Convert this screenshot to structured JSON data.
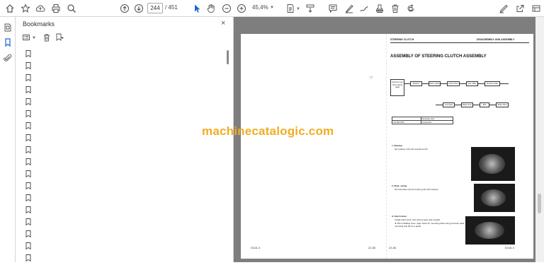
{
  "toolbar": {
    "current_page": "244",
    "total_pages": "/ 451",
    "zoom": "45,4%"
  },
  "bookmarks_panel": {
    "title": "Bookmarks",
    "item_count": 16
  },
  "document": {
    "left_page": {
      "page_number": "22-83",
      "footer_code": "D115-3"
    },
    "right_page": {
      "header_left": "STEERING CLUTCH",
      "header_right": "DISASSEMBLY AND ASSEMBLY",
      "title": "ASSEMBLY OF STEERING CLUTCH ASSEMBLY",
      "flow_top": [
        "Retainer",
        "Plate, spring",
        "Clutch drum",
        "Disc, Plate",
        "Pressure plate"
      ],
      "flow_bottom": [
        "Lock plate",
        "Brake drum",
        "Bolt",
        "Brake band"
      ],
      "flow_start_label": "Clutch & inner drum (spring cage)",
      "table": {
        "header": [
          "",
          "Necessary tools"
        ],
        "row": [
          "791-552-1500",
          "Compressor"
        ]
      },
      "steps": [
        {
          "title": "1. Retainer",
          "text": "Set retainer (13) with special tool B."
        },
        {
          "title": "2. Plate, spring",
          "text": "Set bolt plate (12) and spring (11) with retainer."
        },
        {
          "title": "3. Clutch drum",
          "text": "Install clutch drum (10) with its gear side upward."
        },
        {
          "title": "",
          "text": "★ After installing drum, align holes for mounting bolts using pressure plate mounting bolt (8) as a guide."
        }
      ],
      "page_number": "22-84",
      "footer_code": "D115-3"
    },
    "watermark": "machinecatalogic.com"
  }
}
